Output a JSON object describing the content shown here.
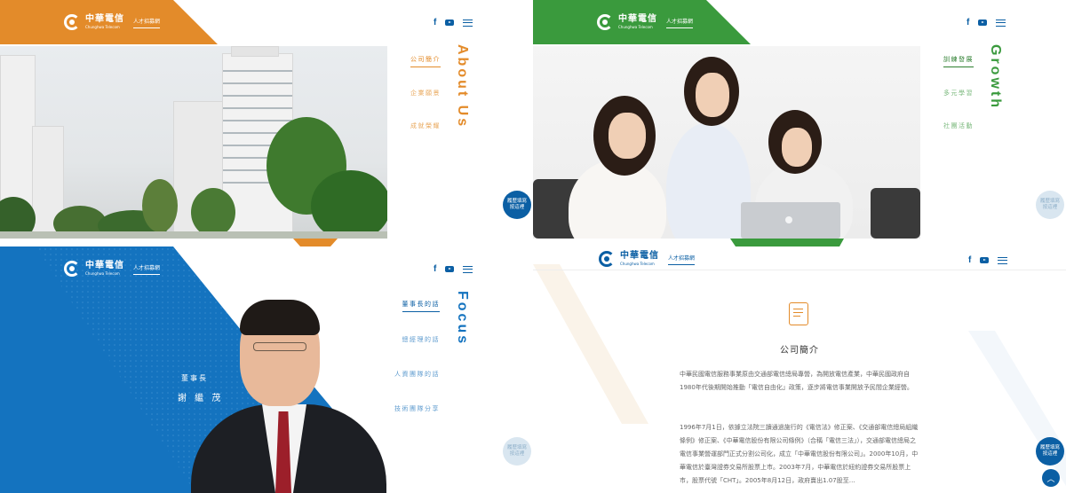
{
  "brand": {
    "name_zh": "中華電信",
    "name_en": "Chunghwa Telecom",
    "sub": "人才招募網"
  },
  "social": {
    "fb": "f"
  },
  "recruit_button": {
    "line1": "履歷填寫",
    "line2": "按這裡"
  },
  "colors": {
    "orange": "#e38b2a",
    "green": "#3a9a3d",
    "blue": "#1473bf",
    "darkblue": "#0b5fa4"
  },
  "about": {
    "title": "About Us",
    "menu": [
      "公司簡介",
      "企業願景",
      "成就榮耀"
    ],
    "active": 0
  },
  "growth": {
    "title": "Growth",
    "menu": [
      "訓練發展",
      "多元學習",
      "社團活動"
    ],
    "active": 0
  },
  "focus": {
    "title": "Focus",
    "menu": [
      "董事長的話",
      "總經理的話",
      "人資團隊的話",
      "技術團隊分享"
    ],
    "active": 0,
    "person_title": "董事長",
    "person_name": "謝 繼 茂"
  },
  "intro": {
    "heading": "公司簡介",
    "icon": "scroll-icon",
    "para1": "中華民國電信服務事業原由交通部電信總局專營，為開放電信產業，中華民國政府自1980年代後期開始推動「電信自由化」政策，逐步將電信事業開放予民間企業經營。",
    "para2": "1996年7月1日，依據立法院三讀通過施行的《電信法》修正案、《交通部電信總局組織條例》修正案、《中華電信股份有限公司條例》（合稱「電信三法」），交通部電信總局之電信事業營運部門正式分割公司化，成立「中華電信股份有限公司」。2000年10月，中華電信於臺灣證券交易所股票上市。2003年7月，中華電信於紐約證券交易所股票上市，股票代號「CHT」。2005年8月12日，政府賣出1.07股至…"
  }
}
